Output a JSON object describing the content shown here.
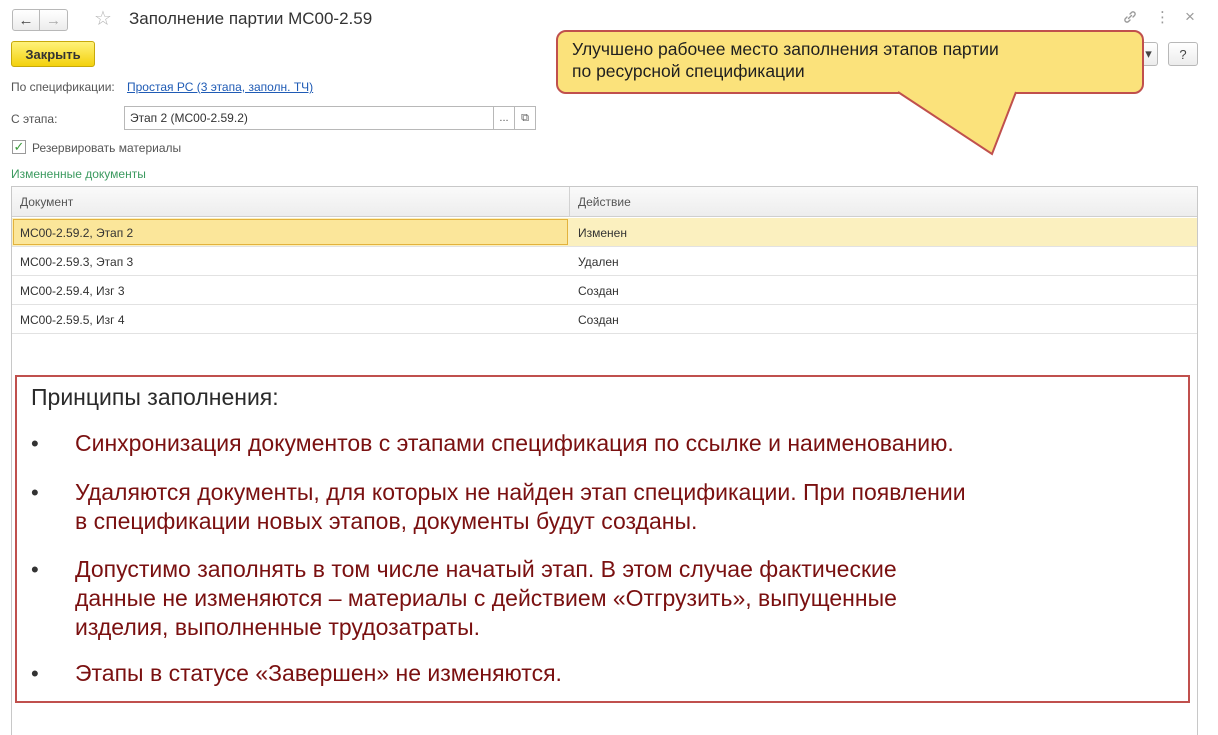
{
  "window": {
    "title": "Заполнение партии МС00-2.59",
    "back_icon": "←",
    "forward_icon": "→",
    "star_icon": "☆",
    "link_icon": "🔗",
    "more_icon": "⋮",
    "close_icon": "×"
  },
  "toolbar": {
    "close_label": "Закрыть",
    "dropdown_icon": "▾",
    "help_label": "?"
  },
  "form": {
    "spec_label": "По спецификации:",
    "spec_link": "Простая РС (3 этапа, заполн. ТЧ)",
    "stage_label": "С этапа:",
    "stage_value": "Этап 2 (МС00-2.59.2)",
    "select_icon": "...",
    "open_icon": "⧉",
    "reserve_check": "✓",
    "reserve_label": "Резервировать материалы",
    "section_title": "Измененные документы"
  },
  "table": {
    "columns": [
      "Документ",
      "Действие"
    ],
    "rows": [
      {
        "doc": "МС00-2.59.2, Этап 2",
        "action": "Изменен"
      },
      {
        "doc": "МС00-2.59.3, Этап 3",
        "action": "Удален"
      },
      {
        "doc": "МС00-2.59.4, Изг 3",
        "action": "Создан"
      },
      {
        "doc": "МС00-2.59.5, Изг 4",
        "action": "Создан"
      }
    ]
  },
  "callout": {
    "line1": "Улучшено рабочее место заполнения этапов партии",
    "line2": "по ресурсной спецификации"
  },
  "principles": {
    "title": "Принципы заполнения:",
    "bullet_char": "•",
    "items": [
      {
        "lines": [
          "Синхронизация документов с этапами спецификация по ссылке и наименованию."
        ]
      },
      {
        "lines": [
          "Удаляются документы, для которых не найден этап спецификации. При появлении",
          "в спецификации новых этапов, документы будут созданы."
        ]
      },
      {
        "lines": [
          "Допустимо заполнять в том числе начатый этап. В этом случае фактические",
          "данные не изменяются – материалы с действием «Отгрузить», выпущенные",
          "изделия, выполненные трудозатраты."
        ]
      },
      {
        "lines": [
          "Этапы в статусе «Завершен» не изменяются."
        ]
      }
    ]
  }
}
